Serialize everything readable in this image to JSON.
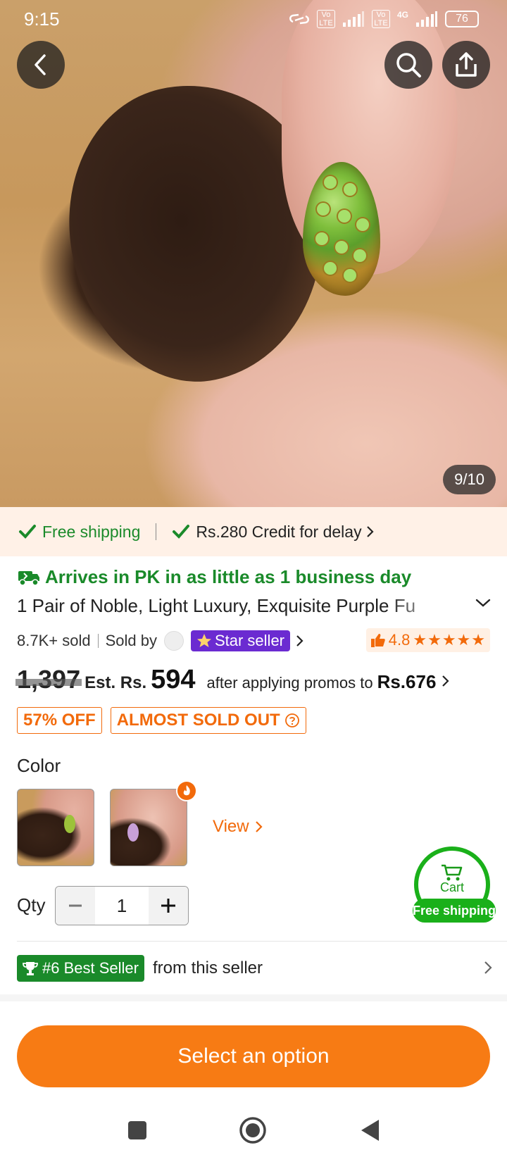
{
  "status_bar": {
    "time": "9:15",
    "net1": "Vo LTE",
    "net2": "Vo LTE",
    "net_type": "4G",
    "battery": "76"
  },
  "hero": {
    "image_counter": "9/10"
  },
  "shipping_banner": {
    "free_shipping": "Free shipping",
    "credit": "Rs.280 Credit for delay"
  },
  "product": {
    "arrives": "Arrives in PK in as little as 1 business day",
    "title": "1 Pair of Noble, Light Luxury, Exquisite Purple Fu",
    "sold": "8.7K+ sold",
    "sold_by": "Sold by",
    "star_seller": "Star seller",
    "rating": "4.8",
    "stars": "★★★★★"
  },
  "price": {
    "original": "1,397",
    "est_label": "Est. Rs.",
    "est_value": "594",
    "promo_text": "after applying promos to",
    "promo_value": "Rs.676"
  },
  "badges": {
    "discount": "57% OFF",
    "stock": "ALMOST SOLD OUT"
  },
  "options": {
    "color_label": "Color",
    "view_link": "View",
    "qty_label": "Qty",
    "qty_value": "1"
  },
  "cart_fab": {
    "label": "Cart",
    "free_shipping": "Free shipping"
  },
  "best_seller": {
    "badge": "#6 Best Seller",
    "text": "from this seller"
  },
  "cta": {
    "label": "Select an option"
  },
  "colors": {
    "accent": "#f77b14",
    "green": "#1a8a2a",
    "star_seller": "#6b2bd1"
  }
}
